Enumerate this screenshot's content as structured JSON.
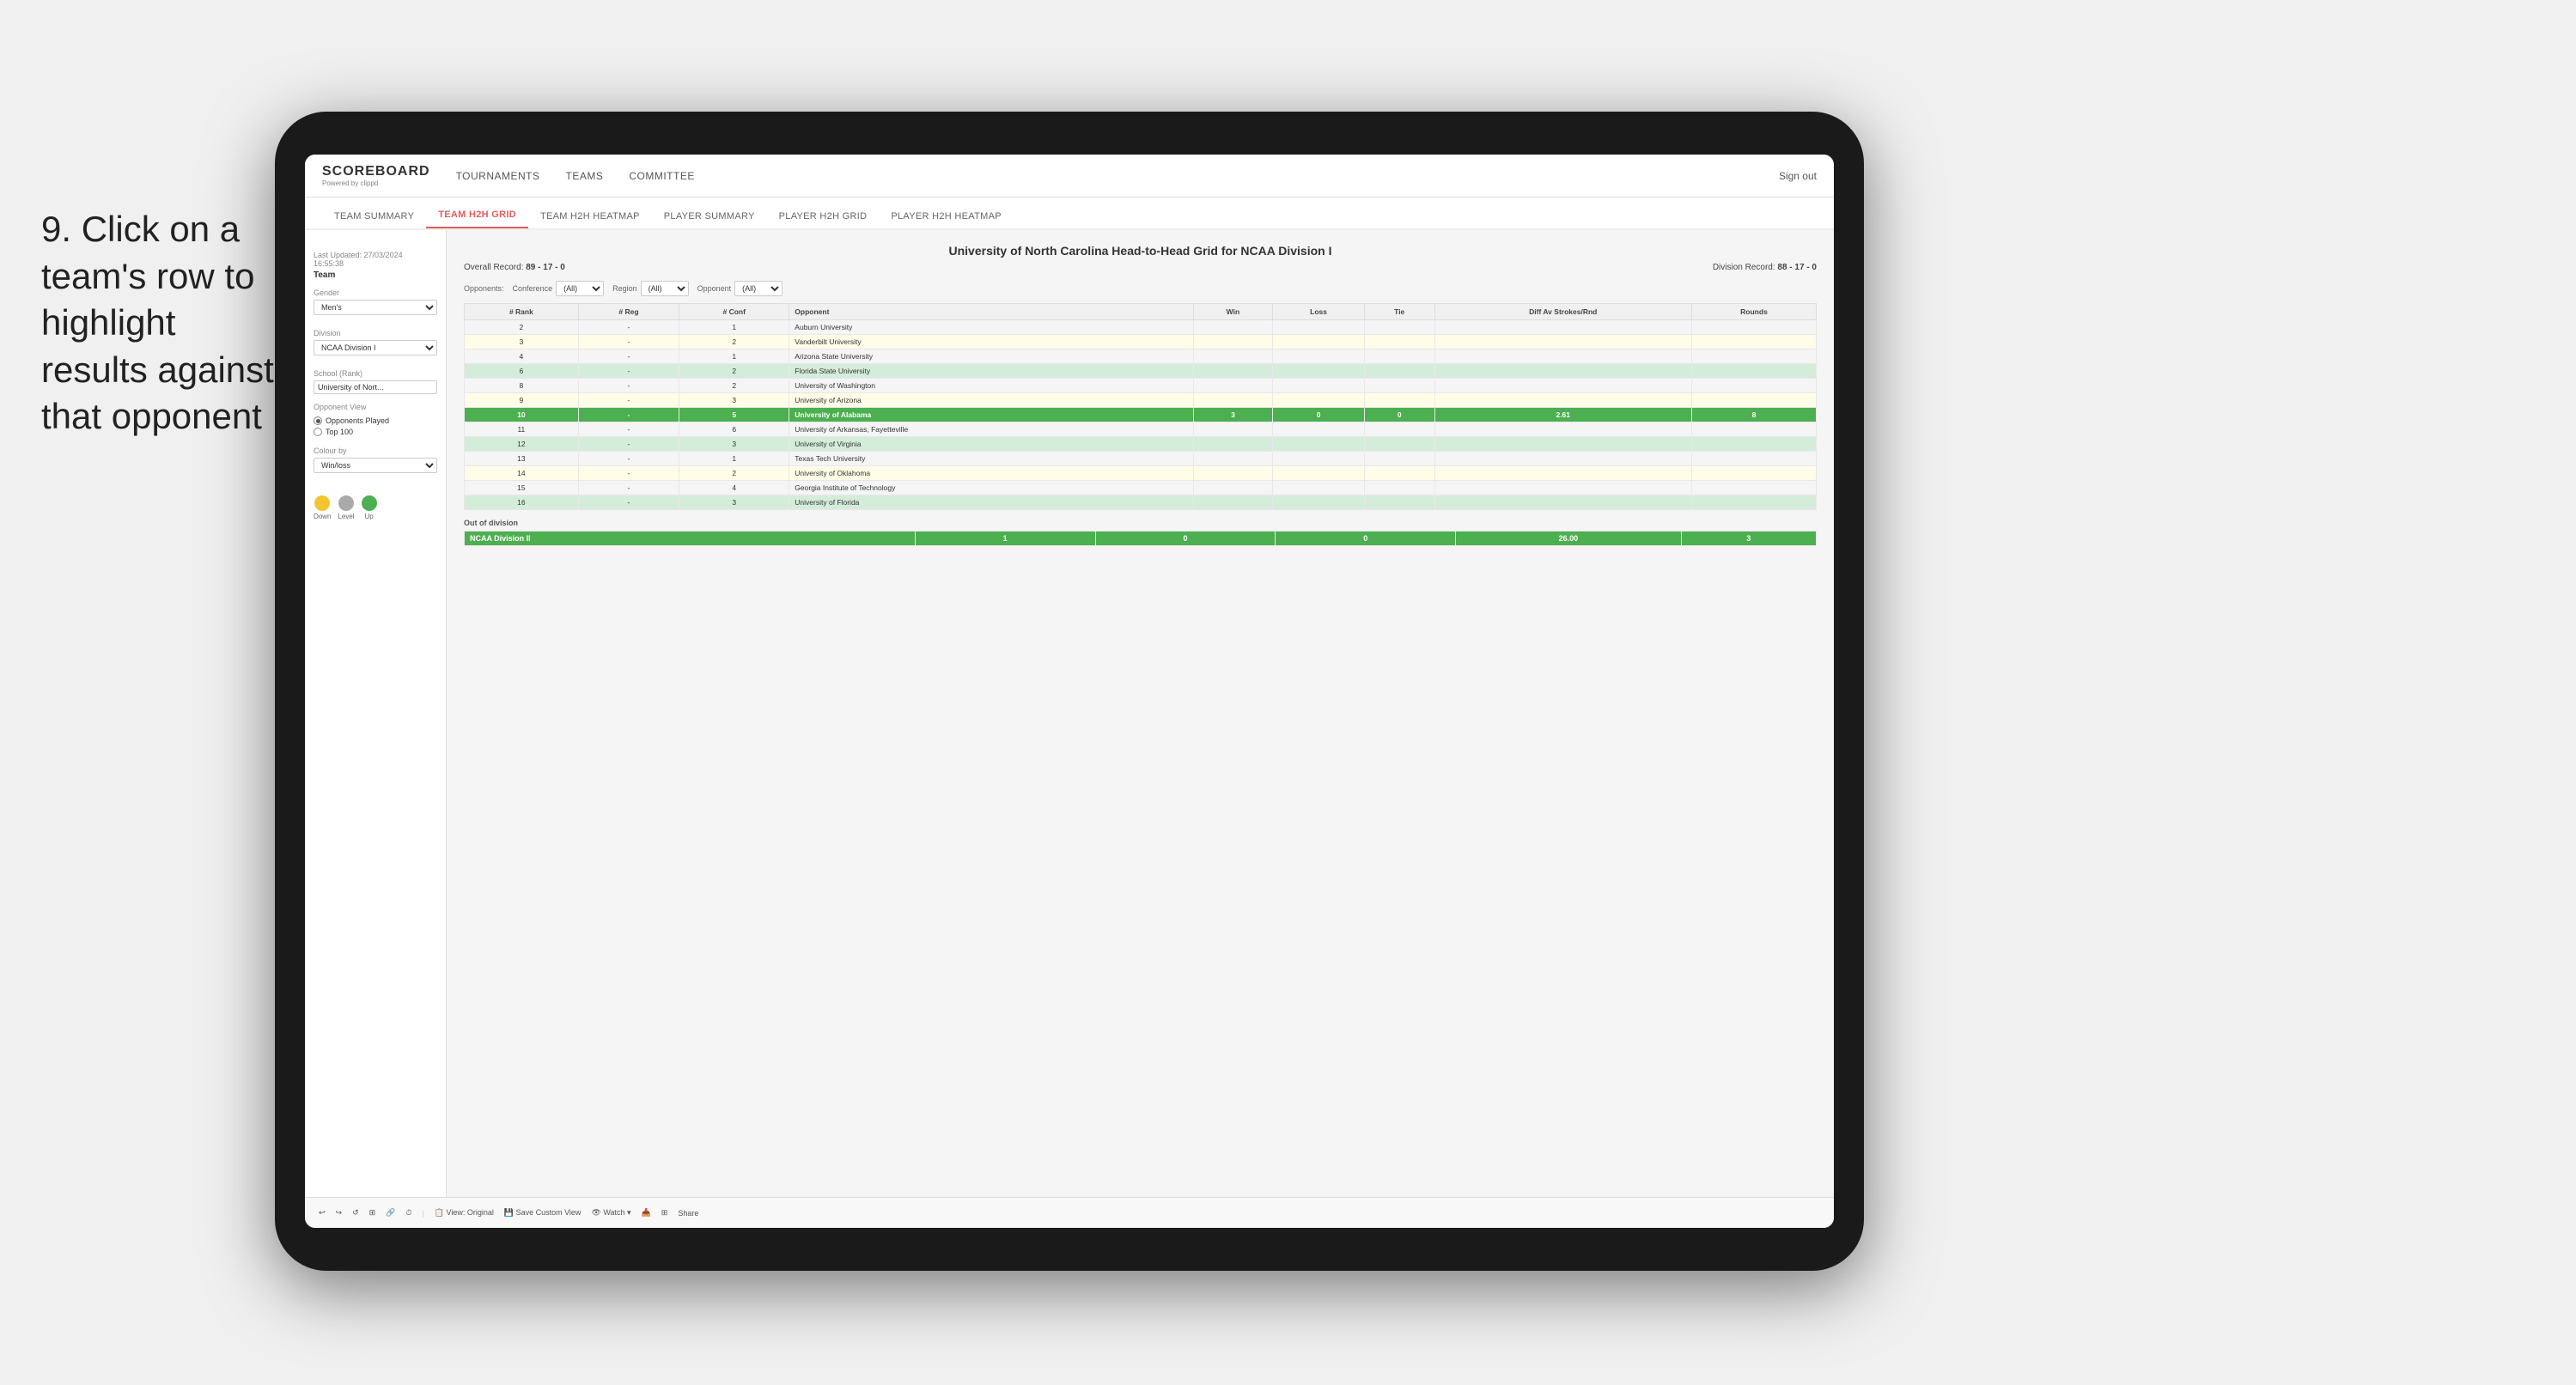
{
  "instruction": {
    "step": "9.",
    "text": "Click on a team's row to highlight results against that opponent"
  },
  "nav": {
    "logo": "SCOREBOARD",
    "logo_sub": "Powered by clippd",
    "items": [
      "TOURNAMENTS",
      "TEAMS",
      "COMMITTEE"
    ],
    "sign_out": "Sign out"
  },
  "sub_nav": {
    "items": [
      "TEAM SUMMARY",
      "TEAM H2H GRID",
      "TEAM H2H HEATMAP",
      "PLAYER SUMMARY",
      "PLAYER H2H GRID",
      "PLAYER H2H HEATMAP"
    ],
    "active": "TEAM H2H GRID"
  },
  "sidebar": {
    "team_label": "Team",
    "gender_label": "Gender",
    "gender_value": "Men's",
    "division_label": "Division",
    "division_value": "NCAA Division I",
    "school_label": "School (Rank)",
    "school_value": "University of Nort...",
    "opponent_view_label": "Opponent View",
    "opponent_options": [
      "Opponents Played",
      "Top 100"
    ],
    "opponent_selected": "Opponents Played",
    "colour_by_label": "Colour by",
    "colour_by_value": "Win/loss",
    "legend": {
      "down_label": "Down",
      "level_label": "Level",
      "up_label": "Up",
      "down_color": "#f4c430",
      "level_color": "#aaa",
      "up_color": "#4caf50"
    }
  },
  "grid": {
    "last_updated_label": "Last Updated: 27/03/2024",
    "last_updated_time": "16:55:38",
    "title": "University of North Carolina Head-to-Head Grid for NCAA Division I",
    "overall_record_label": "Overall Record:",
    "overall_record": "89 - 17 - 0",
    "division_record_label": "Division Record:",
    "division_record": "88 - 17 - 0",
    "filters": {
      "opponents_label": "Opponents:",
      "conference_label": "Conference",
      "conference_value": "(All)",
      "region_label": "Region",
      "region_value": "(All)",
      "opponent_label": "Opponent",
      "opponent_value": "(All)"
    },
    "columns": [
      "# Rank",
      "# Reg",
      "# Conf",
      "Opponent",
      "Win",
      "Loss",
      "Tie",
      "Diff Av Strokes/Rnd",
      "Rounds"
    ],
    "rows": [
      {
        "rank": "2",
        "reg": "-",
        "conf": "1",
        "opponent": "Auburn University",
        "win": "",
        "loss": "",
        "tie": "",
        "diff": "",
        "rounds": "",
        "highlight": false,
        "row_class": ""
      },
      {
        "rank": "3",
        "reg": "-",
        "conf": "2",
        "opponent": "Vanderbilt University",
        "win": "",
        "loss": "",
        "tie": "",
        "diff": "",
        "rounds": "",
        "highlight": false,
        "row_class": "cell-yellow-light"
      },
      {
        "rank": "4",
        "reg": "-",
        "conf": "1",
        "opponent": "Arizona State University",
        "win": "",
        "loss": "",
        "tie": "",
        "diff": "",
        "rounds": "",
        "highlight": false,
        "row_class": ""
      },
      {
        "rank": "6",
        "reg": "-",
        "conf": "2",
        "opponent": "Florida State University",
        "win": "",
        "loss": "",
        "tie": "",
        "diff": "",
        "rounds": "",
        "highlight": false,
        "row_class": "cell-green-light"
      },
      {
        "rank": "8",
        "reg": "-",
        "conf": "2",
        "opponent": "University of Washington",
        "win": "",
        "loss": "",
        "tie": "",
        "diff": "",
        "rounds": "",
        "highlight": false,
        "row_class": ""
      },
      {
        "rank": "9",
        "reg": "-",
        "conf": "3",
        "opponent": "University of Arizona",
        "win": "",
        "loss": "",
        "tie": "",
        "diff": "",
        "rounds": "",
        "highlight": false,
        "row_class": "cell-yellow-light"
      },
      {
        "rank": "10",
        "reg": "-",
        "conf": "5",
        "opponent": "University of Alabama",
        "win": "3",
        "loss": "0",
        "tie": "0",
        "diff": "2.61",
        "rounds": "8",
        "highlight": true,
        "row_class": "row-highlighted"
      },
      {
        "rank": "11",
        "reg": "-",
        "conf": "6",
        "opponent": "University of Arkansas, Fayetteville",
        "win": "",
        "loss": "",
        "tie": "",
        "diff": "",
        "rounds": "",
        "highlight": false,
        "row_class": ""
      },
      {
        "rank": "12",
        "reg": "-",
        "conf": "3",
        "opponent": "University of Virginia",
        "win": "",
        "loss": "",
        "tie": "",
        "diff": "",
        "rounds": "",
        "highlight": false,
        "row_class": "cell-green-light"
      },
      {
        "rank": "13",
        "reg": "-",
        "conf": "1",
        "opponent": "Texas Tech University",
        "win": "",
        "loss": "",
        "tie": "",
        "diff": "",
        "rounds": "",
        "highlight": false,
        "row_class": ""
      },
      {
        "rank": "14",
        "reg": "-",
        "conf": "2",
        "opponent": "University of Oklahoma",
        "win": "",
        "loss": "",
        "tie": "",
        "diff": "",
        "rounds": "",
        "highlight": false,
        "row_class": "cell-yellow-light"
      },
      {
        "rank": "15",
        "reg": "-",
        "conf": "4",
        "opponent": "Georgia Institute of Technology",
        "win": "",
        "loss": "",
        "tie": "",
        "diff": "",
        "rounds": "",
        "highlight": false,
        "row_class": ""
      },
      {
        "rank": "16",
        "reg": "-",
        "conf": "3",
        "opponent": "University of Florida",
        "win": "",
        "loss": "",
        "tie": "",
        "diff": "",
        "rounds": "",
        "highlight": false,
        "row_class": "cell-green-light"
      }
    ],
    "out_of_division_label": "Out of division",
    "out_of_division_row": {
      "label": "NCAA Division II",
      "win": "1",
      "loss": "0",
      "tie": "0",
      "diff": "26.00",
      "rounds": "3"
    }
  },
  "toolbar": {
    "buttons": [
      "↩",
      "↪",
      "↺",
      "⊞",
      "🔗",
      "⏱",
      "View: Original",
      "Save Custom View",
      "👁 Watch ▾",
      "📥",
      "⊞",
      "Share"
    ]
  }
}
